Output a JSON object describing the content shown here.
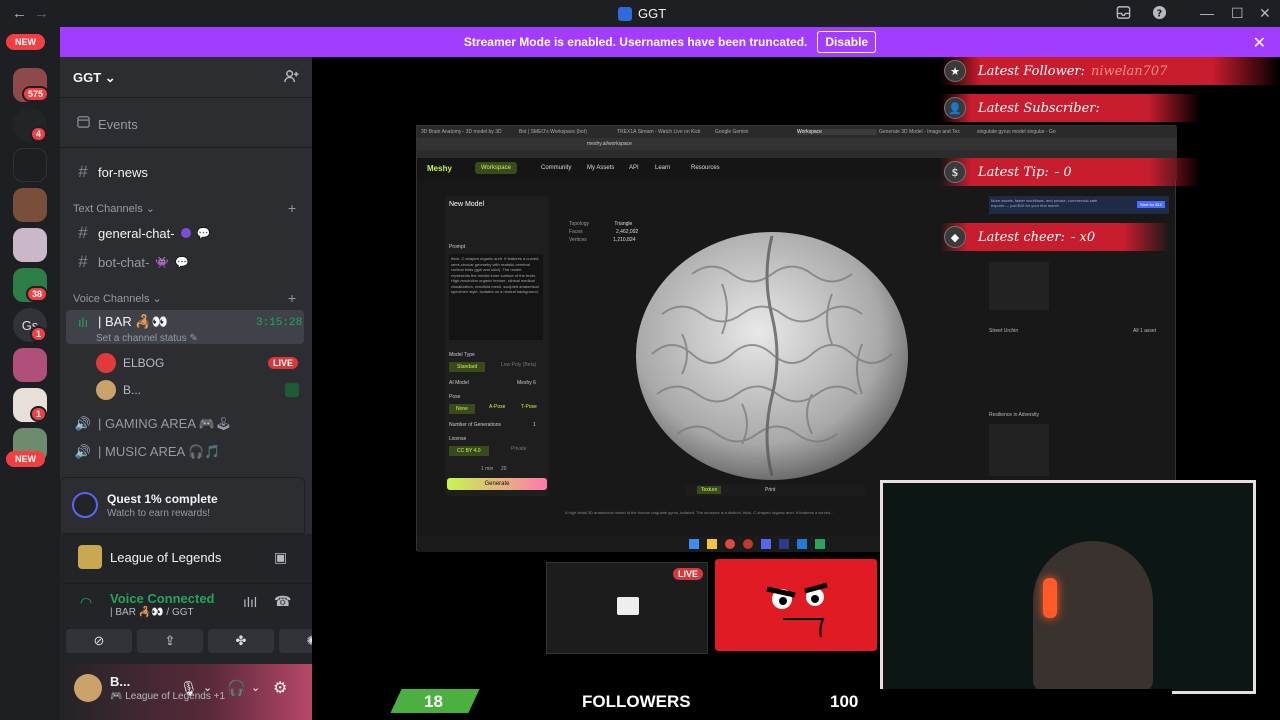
{
  "window": {
    "title": "GGT",
    "nav_back": "←",
    "nav_forward": "→"
  },
  "banner": {
    "text": "Streamer Mode is enabled. Usernames have been truncated.",
    "button": "Disable",
    "close": "✕"
  },
  "rail": {
    "new_top": "NEW",
    "new_bottom": "NEW",
    "badges": [
      "575",
      "4",
      "38",
      "1",
      "1",
      "1"
    ],
    "gs_label": "Gs"
  },
  "server": {
    "name": "GGT"
  },
  "channels": {
    "events": "Events",
    "for_news": "for-news",
    "text_category": "Text Channels",
    "general": "general-chat-",
    "bot": "bot-chat-",
    "voice_category": "Voice Channels",
    "bar": "| BAR 🦂👀",
    "bar_time": "3:15:28",
    "bar_status": "Set a channel status",
    "member1": "ELBOG",
    "member1_badge": "LIVE",
    "member2": "B...",
    "gaming": "| GAMING AREA 🎮🕹",
    "music": "| MUSIC AREA 🎧🎵"
  },
  "quest": {
    "title": "Quest 1% complete",
    "subtitle": "Watch to earn rewards!"
  },
  "activity": {
    "game": "League of Legends"
  },
  "voice": {
    "status": "Voice Connected",
    "channel": "| BAR 🦂👀 / GGT"
  },
  "user": {
    "name": "B...",
    "activity": "League of Legends +1"
  },
  "stream": {
    "overlays": {
      "follower_label": "Latest Follower:",
      "follower_value": "niwelan707",
      "subscriber_label": "Latest Subscriber:",
      "tip_label": "Latest Tip:",
      "tip_value": "- 0",
      "cheer_label": "Latest cheer:",
      "cheer_value": "- x0"
    },
    "live_badge": "LIVE",
    "followers": {
      "current": "18",
      "label": "FOLLOWERS",
      "goal": "100"
    },
    "meshy": {
      "tabs": [
        "3D Brain Anatomy - 3D model by 3D",
        "Bot | SMEO's Workspace (bot)",
        "TREX1A Stream - Watch Live on Kick",
        "Google Gemini",
        "Workspace",
        "Generate 3D Model - Image and Tex",
        "singulate gyrus model singular - Go"
      ],
      "url": "meshy.ai/workspace",
      "brand": "Meshy",
      "nav": [
        "Workspace",
        "Community",
        "My Assets",
        "API",
        "Learn",
        "Resources"
      ],
      "panel_title": "New Model",
      "prompt_label": "Prompt",
      "prompt_text": "thick, C-shaped organic arch. It features a curved, semi-circular geometry with realistic cerebral cortical folds (gyri and sulci). The model represents the medial inner surface of the brain. High-resolution organic texture, clinical medical visualization, manifold mesh, sculpted anatomical specimen style, isolated on a neutral background.",
      "model_type_label": "Model Type",
      "model_type_options": [
        "Standard",
        "Low Poly (Beta)"
      ],
      "ai_model_label": "AI Model",
      "ai_model_value": "Meshy 6",
      "pose_label": "Pose",
      "pose_options": [
        "None",
        "A-Pose",
        "T-Pose"
      ],
      "gens_label": "Number of Generations",
      "gens_value": "1",
      "license_label": "License",
      "license_value": "CC BY 4.0",
      "license_private": "Private",
      "time_cost": "1 min",
      "credits": "20",
      "generate": "Generate",
      "topology_label": "Topology",
      "topology_value": "Triangle",
      "faces_label": "Faces",
      "faces_value": "2,462,092",
      "vertices_label": "Vertices",
      "vertices_value": "1,210,824",
      "right_label1": "Street Urchin",
      "right_label2": "Resilience in Adversity",
      "all_assets": "All 1 asset",
      "promo": "More assets, faster workflows, and private, commercial-safe exports — just $10 for your first month.",
      "promo_btn": "Start for $10",
      "caption": "A high detail 3D anatomical model of the human cingulate gyrus, isolated. The structure is a distinct, thick, C-shaped organic arch. It features a curved...",
      "toolbar_texture": "Texture",
      "toolbar_print": "Print"
    }
  },
  "colors": {
    "accent": "#a23dff",
    "red": "#f23f43",
    "green": "#23a559",
    "overlay": "#c81d2e"
  }
}
